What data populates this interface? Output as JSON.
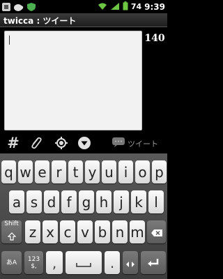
{
  "statusbar": {
    "battery": "74",
    "time": "9:39",
    "icons": [
      "usb-icon",
      "coffee-icon",
      "shield-icon",
      "wifi-icon",
      "signal-icon",
      "battery-icon"
    ]
  },
  "app": {
    "title": "twicca : ツイート"
  },
  "compose": {
    "value": "",
    "counter": "140"
  },
  "actions": {
    "icons": [
      "hashtag-icon",
      "attachment-icon",
      "location-icon",
      "menu-down-icon",
      "speech-bubble-icon"
    ],
    "hash_symbol": "#",
    "tweet_label": "ツイート"
  },
  "keyboard": {
    "row1": [
      "q",
      "w",
      "e",
      "r",
      "t",
      "y",
      "u",
      "i",
      "o",
      "p"
    ],
    "row2": [
      "a",
      "s",
      "d",
      "f",
      "g",
      "h",
      "j",
      "k",
      "l"
    ],
    "row3": [
      "z",
      "x",
      "c",
      "v",
      "b",
      "n",
      "m"
    ],
    "shift": "Shift",
    "mode_key": "あA",
    "num_key_top": "123",
    "num_key_bottom": "$,",
    "comma": ",",
    "period": "."
  }
}
